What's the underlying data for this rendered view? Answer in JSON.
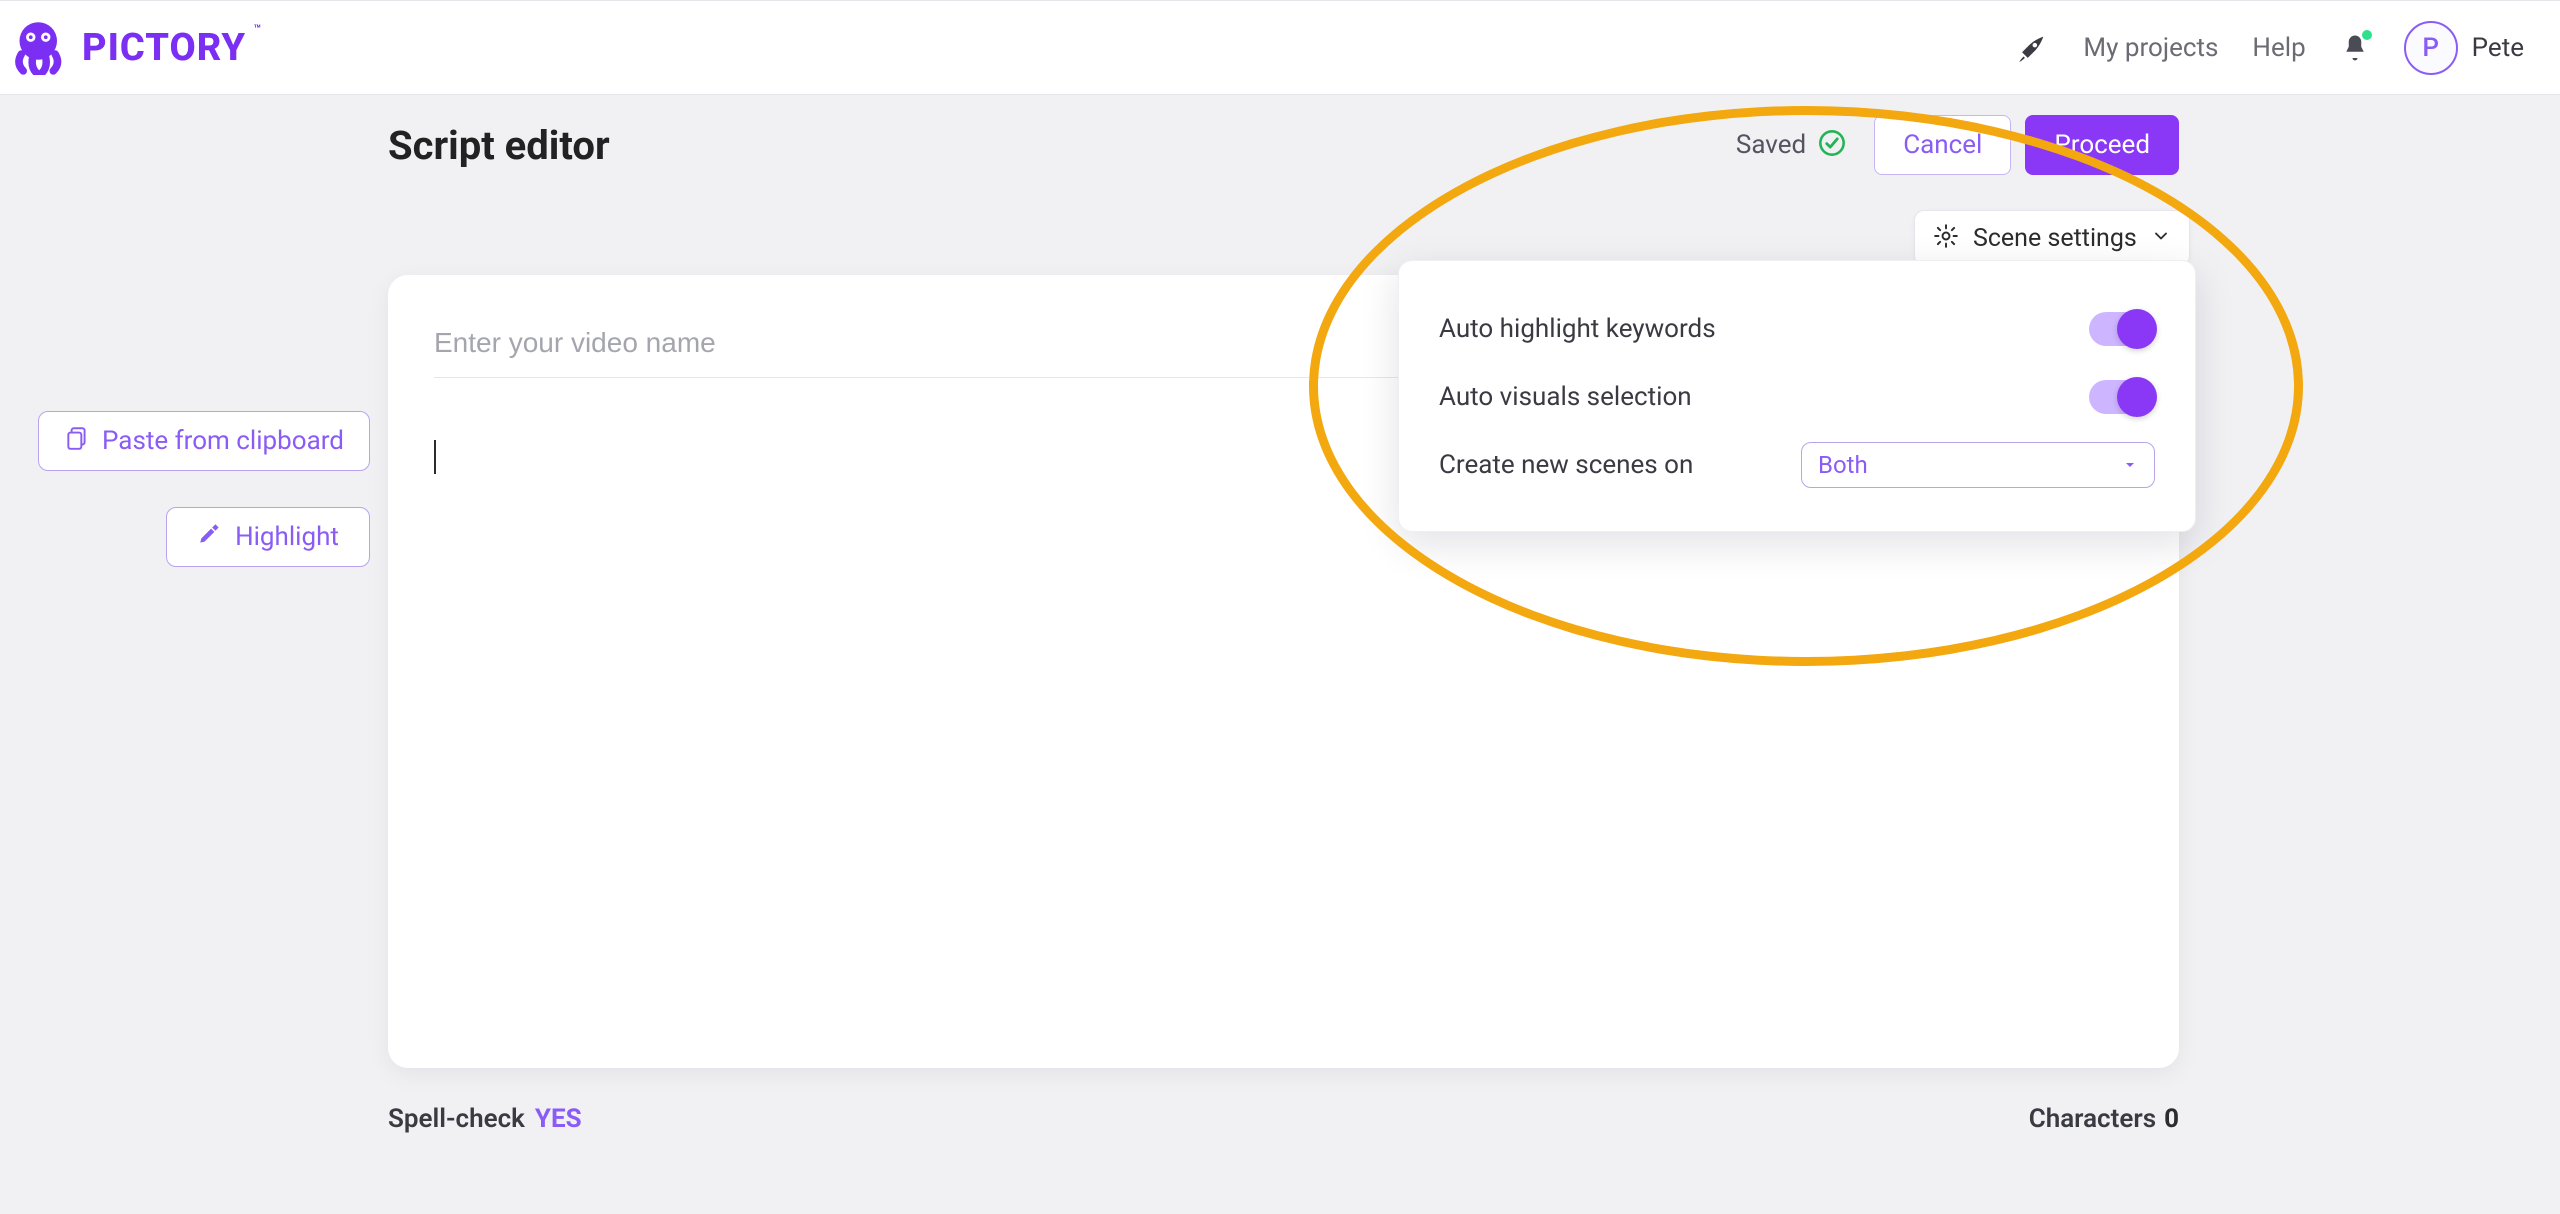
{
  "brand": {
    "name": "PICTORY",
    "tm": "™"
  },
  "nav": {
    "my_projects": "My projects",
    "help": "Help",
    "user_initial": "P",
    "user_name": "Pete"
  },
  "page": {
    "title": "Script editor",
    "saved_label": "Saved",
    "cancel_label": "Cancel",
    "proceed_label": "Proceed"
  },
  "scene_settings": {
    "trigger_label": "Scene settings",
    "auto_highlight_label": "Auto highlight keywords",
    "auto_highlight_on": true,
    "auto_visuals_label": "Auto visuals selection",
    "auto_visuals_on": true,
    "create_scenes_label": "Create new scenes on",
    "create_scenes_value": "Both"
  },
  "side": {
    "paste_label": "Paste from clipboard",
    "highlight_label": "Highlight"
  },
  "editor": {
    "video_name_placeholder": "Enter your video name",
    "video_name_value": "",
    "script_value": ""
  },
  "footer": {
    "spellcheck_label": "Spell-check",
    "spellcheck_value": "YES",
    "characters_label": "Characters",
    "characters_value": "0"
  },
  "colors": {
    "brand": "#8a38f5",
    "annotation": "#f2a80e"
  }
}
